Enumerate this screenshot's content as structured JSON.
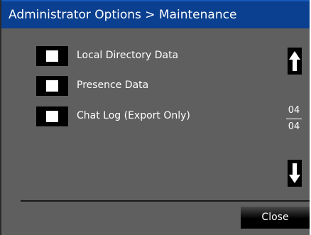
{
  "title_bar": {
    "title": "Administrator Options > Maintenance",
    "background_color": "#0b3f8f"
  },
  "options": [
    {
      "label": "Local Directory Data",
      "checked": false
    },
    {
      "label": "Presence Data",
      "checked": false
    },
    {
      "label": "Chat Log (Export Only)",
      "checked": false
    }
  ],
  "pagination": {
    "current_page": "04",
    "total_pages": "04",
    "up_icon": "arrow-up-icon",
    "down_icon": "arrow-down-icon"
  },
  "footer": {
    "close_label": "Close"
  }
}
